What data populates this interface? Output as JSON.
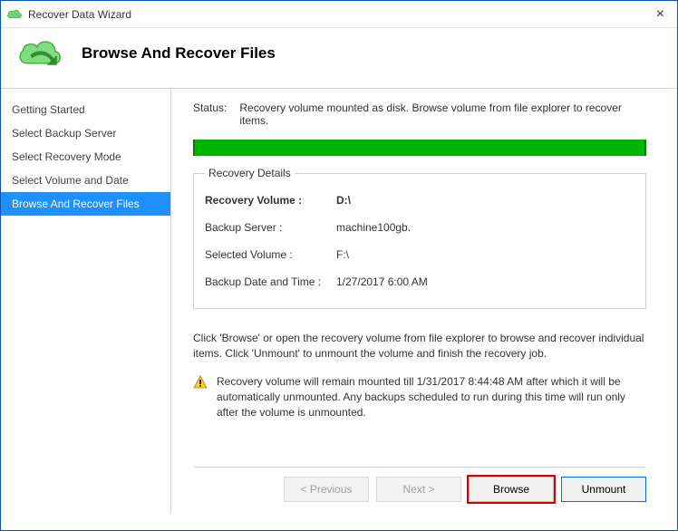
{
  "window": {
    "title": "Recover Data Wizard"
  },
  "header": {
    "title": "Browse And Recover Files"
  },
  "sidebar": {
    "items": [
      {
        "label": "Getting Started"
      },
      {
        "label": "Select Backup Server"
      },
      {
        "label": "Select Recovery Mode"
      },
      {
        "label": "Select Volume and Date"
      },
      {
        "label": "Browse And Recover Files"
      }
    ]
  },
  "main": {
    "status_label": "Status:",
    "status_text": "Recovery volume mounted as disk. Browse volume from file explorer to recover items.",
    "progress_color": "#00b400",
    "details_legend": "Recovery Details",
    "details": {
      "recovery_volume_label": "Recovery Volume :",
      "recovery_volume_value": "D:\\",
      "backup_server_label": "Backup Server :",
      "backup_server_value": "machine100gb.",
      "selected_volume_label": "Selected Volume :",
      "selected_volume_value": "F:\\",
      "backup_datetime_label": "Backup Date and Time :",
      "backup_datetime_value": "1/27/2017 6:00 AM"
    },
    "instruction": "Click 'Browse' or open the recovery volume from file explorer to browse and recover individual items. Click 'Unmount' to unmount the volume and finish the recovery job.",
    "warning": "Recovery volume will remain mounted till 1/31/2017 8:44:48 AM after which it will be automatically unmounted. Any backups scheduled to run during this time will run only after the volume is unmounted."
  },
  "buttons": {
    "previous": "< Previous",
    "next": "Next >",
    "browse": "Browse",
    "unmount": "Unmount"
  }
}
